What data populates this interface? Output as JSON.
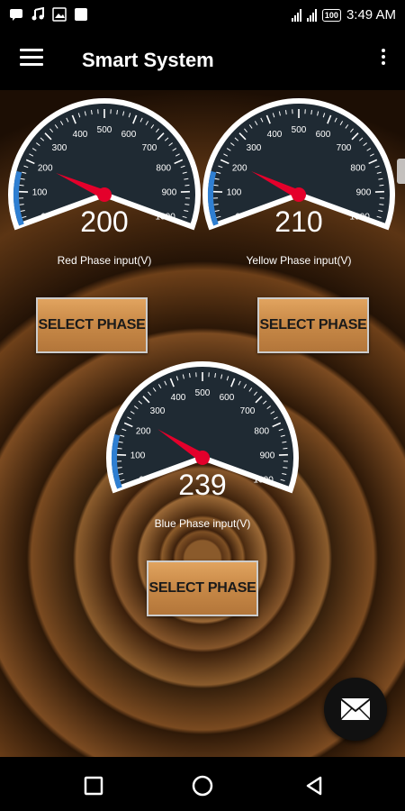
{
  "status_bar": {
    "time": "3:49 AM",
    "battery": "100"
  },
  "app_bar": {
    "title": "Smart System"
  },
  "gauge_scale": {
    "ticks": [
      "0",
      "100",
      "200",
      "300",
      "400",
      "500",
      "600",
      "700",
      "800",
      "900",
      "1000"
    ],
    "min": 0,
    "max": 1000
  },
  "gauges": [
    {
      "value": 200,
      "value_text": "200",
      "label": "Red Phase input(V)"
    },
    {
      "value": 210,
      "value_text": "210",
      "label": "Yellow Phase input(V)"
    },
    {
      "value": 239,
      "value_text": "239",
      "label": "Blue Phase input(V)"
    }
  ],
  "buttons": {
    "select_phase": "SELECT PHASE"
  },
  "colors": {
    "gauge_face": "#1f2a33",
    "gauge_rim": "#ffffff",
    "needle": "#e4002b",
    "arc_accent": "#2f7fd2"
  },
  "icons": {
    "menu": "hamburger-icon",
    "overflow": "more-vert-icon",
    "fab": "mail-icon"
  }
}
